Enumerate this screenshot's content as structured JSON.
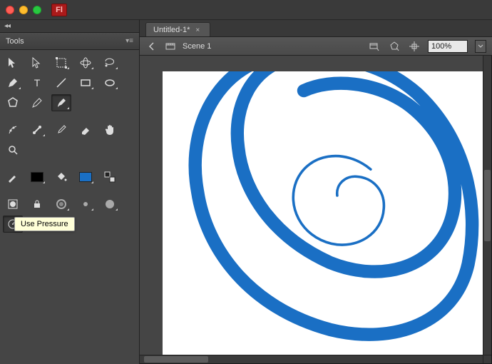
{
  "app": {
    "logo_text": "Fl"
  },
  "tools_panel": {
    "title": "Tools"
  },
  "tooltip": {
    "text": "Use Pressure"
  },
  "document": {
    "tab_label": "Untitled-1*",
    "scene_label": "Scene 1",
    "zoom": "100%"
  },
  "colors": {
    "stroke_swatch": "#000000",
    "fill_swatch": "#1a6fc4",
    "brush_stroke": "#1a6fc4"
  },
  "tools": {
    "row1": [
      "selection",
      "subselection",
      "free-transform",
      "3d-rotation",
      "lasso"
    ],
    "row2": [
      "pen",
      "text",
      "line",
      "rectangle",
      "oval"
    ],
    "row3": [
      "polystar",
      "pencil",
      "brush"
    ],
    "row4": [
      "deco",
      "bone",
      "eyedropper",
      "eraser"
    ],
    "row5": [
      "hand",
      "zoom"
    ],
    "color_row": [
      "stroke-color",
      "fill-color",
      "swap-colors"
    ],
    "opt1": [
      "object-drawing",
      "lock-fill",
      "smoothing",
      "brush-size-sm",
      "brush-size-lg"
    ],
    "opt2": [
      "use-pressure",
      "use-tilt"
    ]
  }
}
